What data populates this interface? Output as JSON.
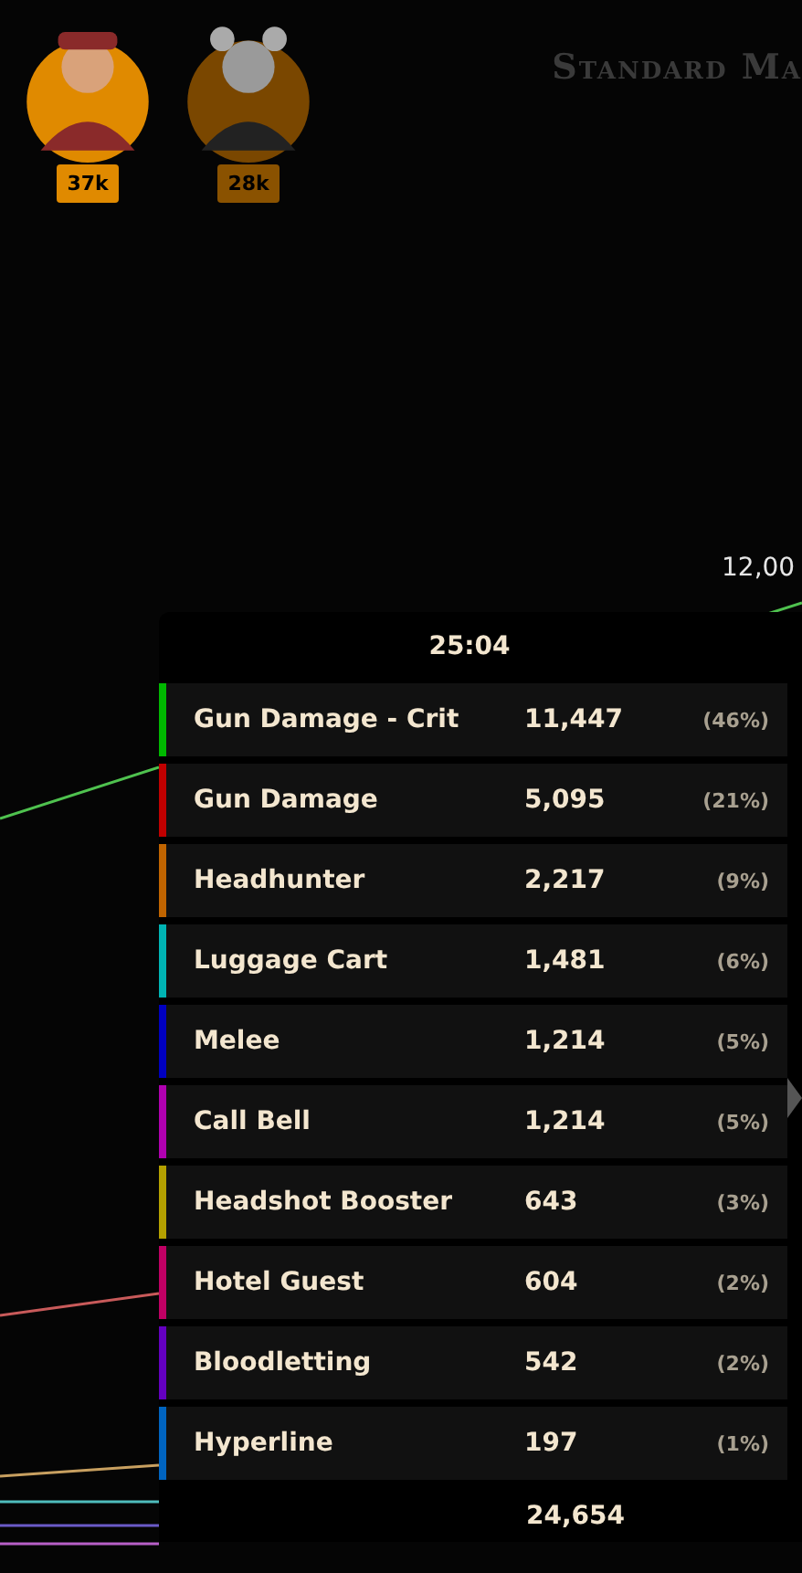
{
  "players": [
    {
      "score": "37k",
      "dimmed": false
    },
    {
      "score": "28k",
      "dimmed": true
    }
  ],
  "title": "Standard Ma",
  "chart": {
    "axis_label": "12,00"
  },
  "tooltip": {
    "time": "25:04",
    "rows": [
      {
        "label": "Gun Damage - Crit",
        "value": "11,447",
        "percent": "(46%)",
        "color": "#00b800"
      },
      {
        "label": "Gun Damage",
        "value": "5,095",
        "percent": "(21%)",
        "color": "#c00000"
      },
      {
        "label": "Headhunter",
        "value": "2,217",
        "percent": "(9%)",
        "color": "#c06400"
      },
      {
        "label": "Luggage Cart",
        "value": "1,481",
        "percent": "(6%)",
        "color": "#00b4b4"
      },
      {
        "label": "Melee",
        "value": "1,214",
        "percent": "(5%)",
        "color": "#0000c0"
      },
      {
        "label": "Call Bell",
        "value": "1,214",
        "percent": "(5%)",
        "color": "#b000b0"
      },
      {
        "label": "Headshot Booster",
        "value": "643",
        "percent": "(3%)",
        "color": "#b4a000"
      },
      {
        "label": "Hotel Guest",
        "value": "604",
        "percent": "(2%)",
        "color": "#c00064"
      },
      {
        "label": "Bloodletting",
        "value": "542",
        "percent": "(2%)",
        "color": "#6400c0"
      },
      {
        "label": "Hyperline",
        "value": "197",
        "percent": "(1%)",
        "color": "#0064c0"
      }
    ],
    "total": "24,654"
  }
}
